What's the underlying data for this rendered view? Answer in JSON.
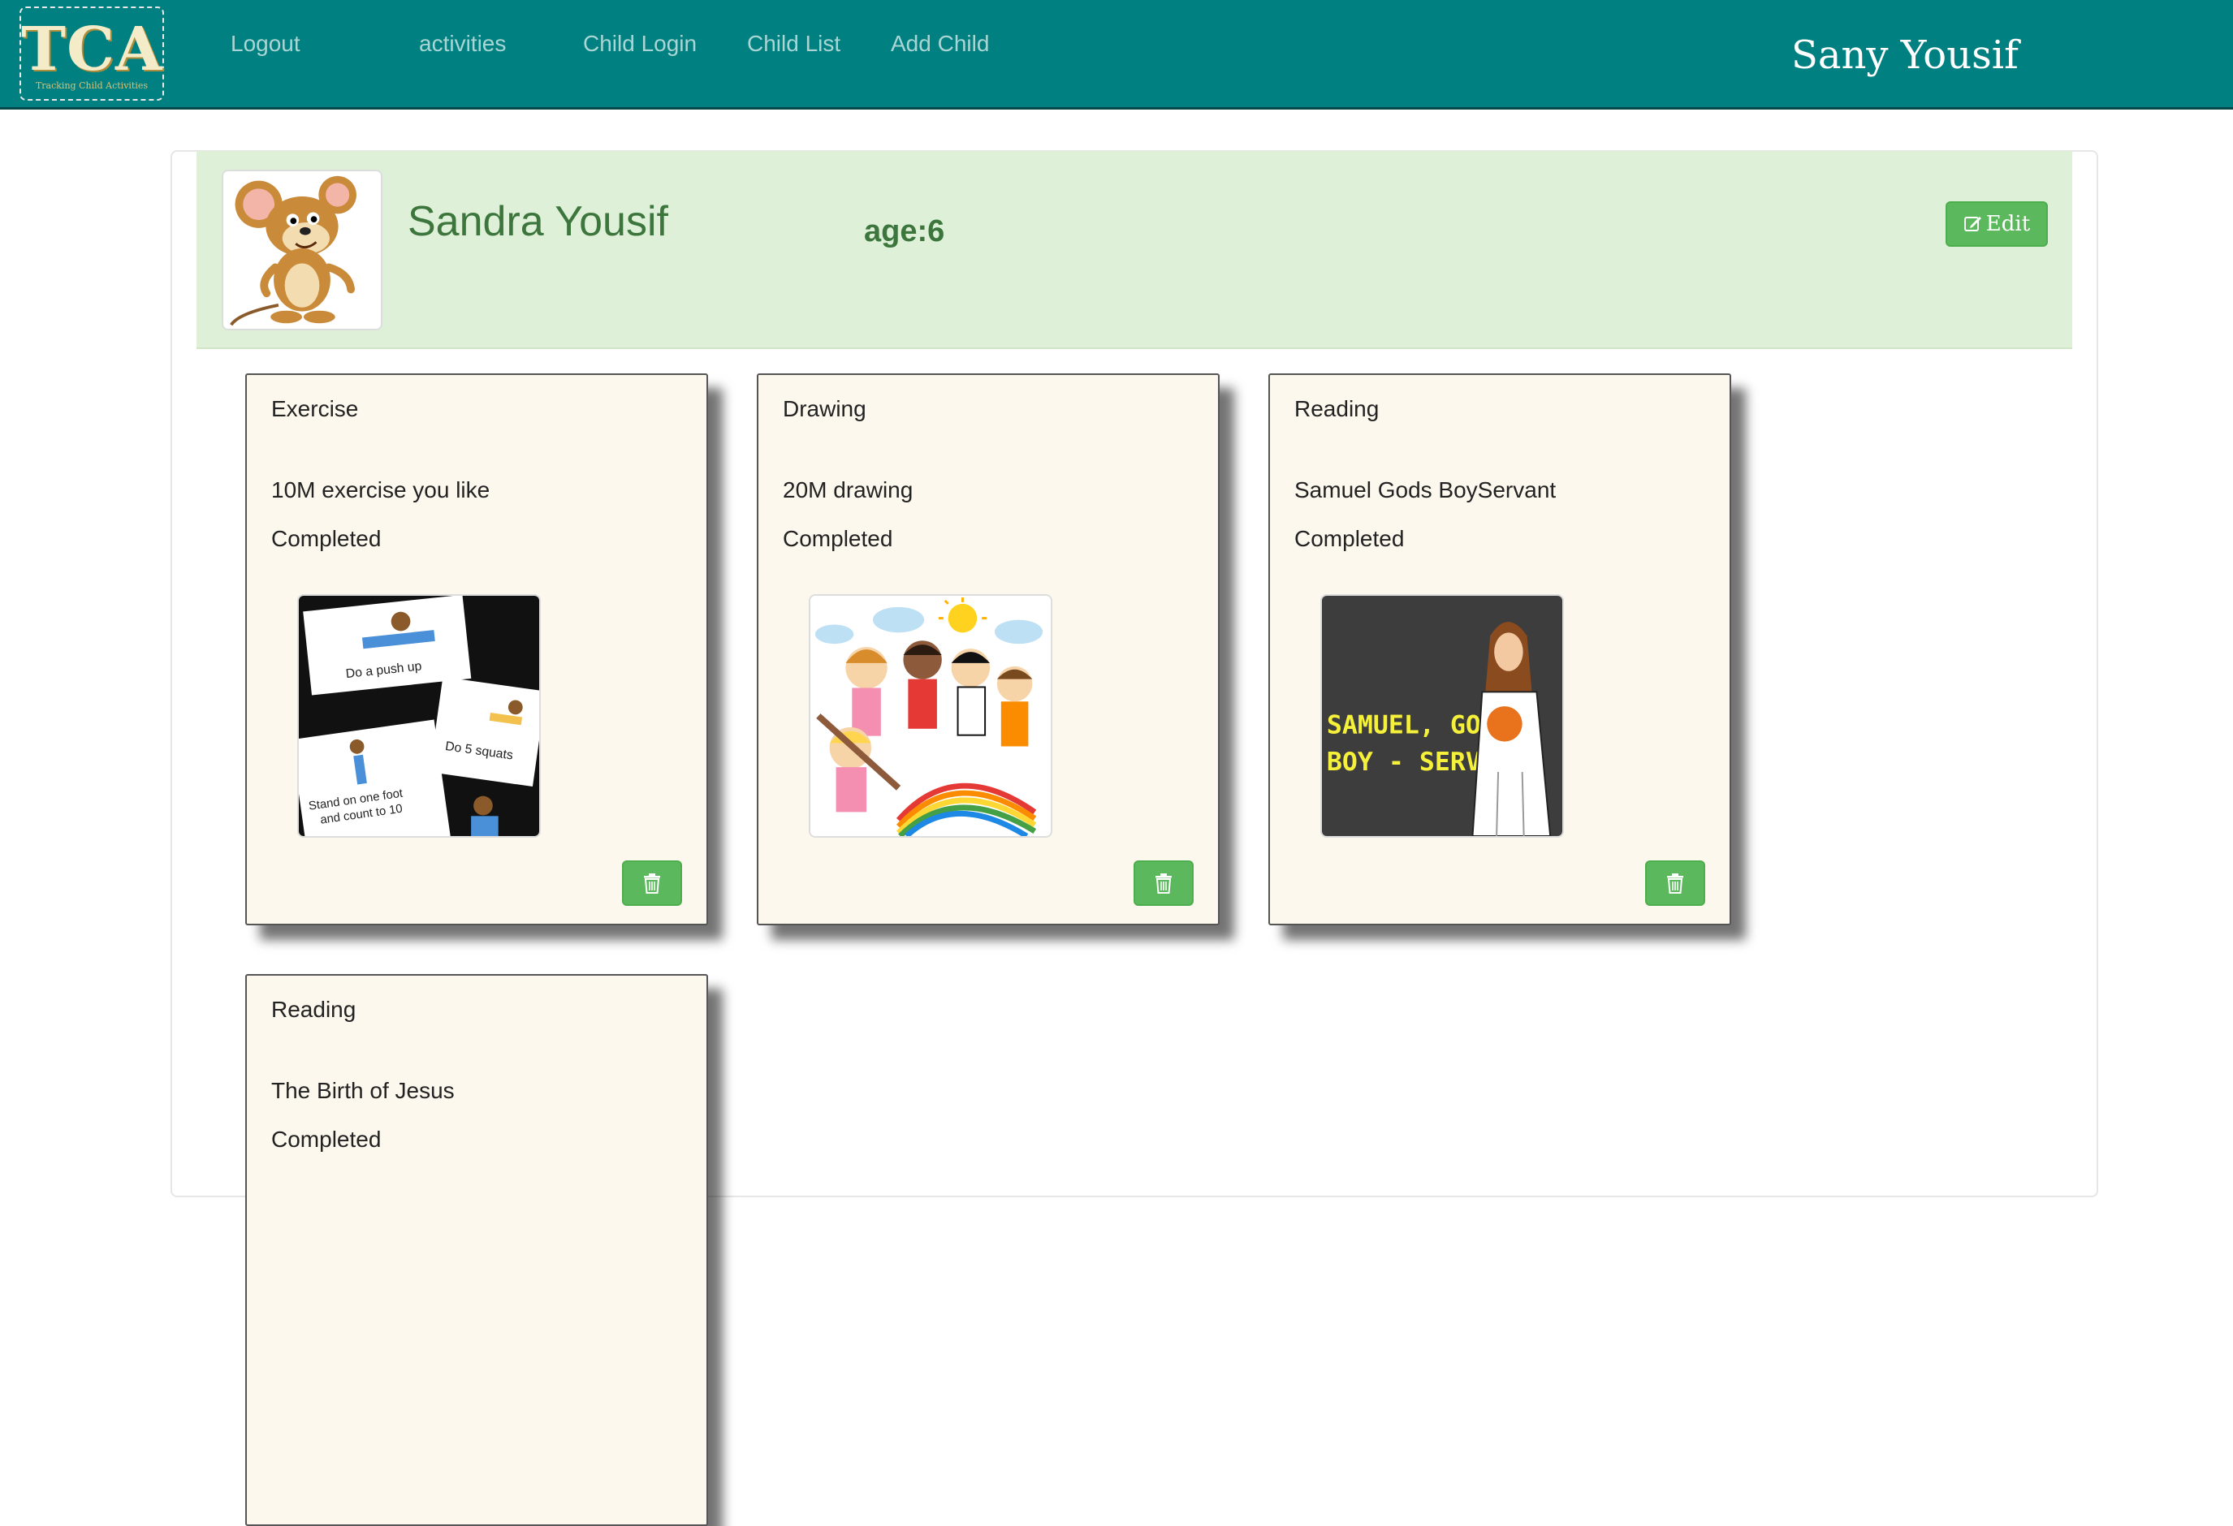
{
  "brand": {
    "logo_text": "TCA",
    "logo_subtitle": "Tracking Child Activities"
  },
  "nav": {
    "links": [
      "Logout",
      "activities",
      "Child Login",
      "Child List",
      "Add Child"
    ],
    "user_name": "Sany Yousif"
  },
  "child": {
    "name": "Sandra Yousif",
    "age_label": "age:6",
    "edit_label": "Edit",
    "avatar_icon": "cartoon-mouse-avatar"
  },
  "activities": [
    {
      "title": "Exercise",
      "description": "10M exercise you like",
      "status": "Completed",
      "image": "exercise-cards-picture"
    },
    {
      "title": "Drawing",
      "description": "20M drawing",
      "status": "Completed",
      "image": "kids-drawing-picture"
    },
    {
      "title": "Reading",
      "description": "Samuel Gods BoyServant",
      "status": "Completed",
      "image": "samuel-book-picture",
      "image_text": [
        "SAMUEL, GOD'S",
        "BOY - SERVANT"
      ]
    },
    {
      "title": "Reading",
      "description": "The Birth of Jesus",
      "status": "Completed",
      "image": ""
    }
  ],
  "exercise_image_text": [
    "Do a push up",
    "Do 5 squats",
    "Stand on one foot",
    "and count to 10"
  ],
  "colors": {
    "navbar": "#008080",
    "profile_bg": "#dff0d8",
    "profile_text": "#3c763d",
    "button_green": "#5cb85c",
    "card_bg": "#fdf8ee"
  }
}
